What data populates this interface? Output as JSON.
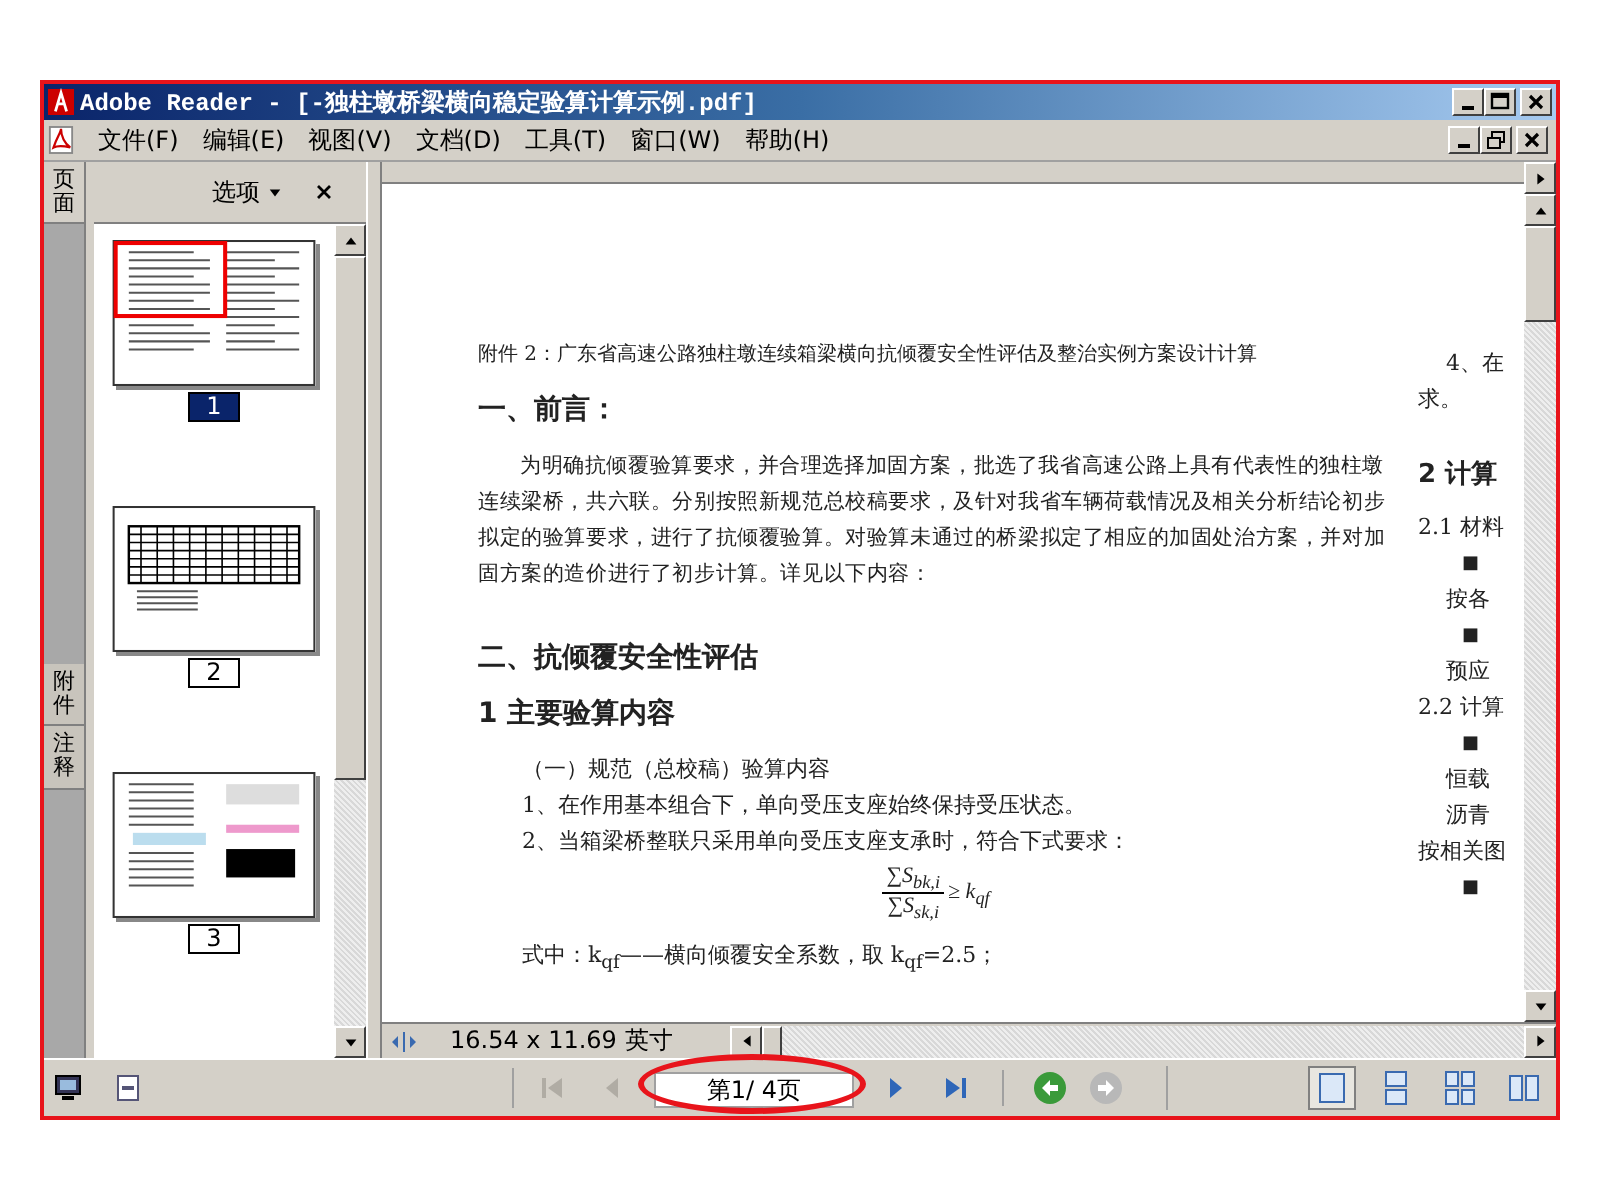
{
  "window": {
    "title": "Adobe Reader - [-独柱墩桥梁横向稳定验算计算示例.pdf]"
  },
  "menu": [
    {
      "label": "文件(F)"
    },
    {
      "label": "编辑(E)"
    },
    {
      "label": "视图(V)"
    },
    {
      "label": "文档(D)"
    },
    {
      "label": "工具(T)"
    },
    {
      "label": "窗口(W)"
    },
    {
      "label": "帮助(H)"
    }
  ],
  "side_tabs": [
    {
      "label": "页面",
      "selected": true
    },
    {
      "label": "附件",
      "selected": false
    },
    {
      "label": "注释",
      "selected": false
    }
  ],
  "panel": {
    "options": "选项"
  },
  "thumbnails": [
    {
      "label": "1",
      "selected": true,
      "kind": "text"
    },
    {
      "label": "2",
      "selected": false,
      "kind": "table"
    },
    {
      "label": "3",
      "selected": false,
      "kind": "figures"
    }
  ],
  "document": {
    "column_1": [
      {
        "kind": "caption",
        "text": "附件 2：广东省高速公路独柱墩连续箱梁横向抗倾覆安全性评估及整治实例方案设计计算"
      },
      {
        "kind": "h1",
        "text": "一、前言："
      },
      {
        "kind": "body",
        "text": "为明确抗倾覆验算要求，并合理选择加固方案，批选了我省高速公路上具有代表性的独柱墩连续梁桥，共六联。分别按照新规范总校稿要求，及针对我省车辆荷载情况及相关分析结论初步拟定的验算要求，进行了抗倾覆验算。对验算未通过的桥梁拟定了相应的加固处治方案，并对加固方案的造价进行了初步计算。详见以下内容："
      },
      {
        "kind": "h1",
        "text": "二、抗倾覆安全性评估"
      },
      {
        "kind": "h1",
        "text": "1  主要验算内容"
      },
      {
        "kind": "item",
        "text": "（一）规范（总校稿）验算内容"
      },
      {
        "kind": "item",
        "text": "1、在作用基本组合下，单向受压支座始终保持受压状态。"
      },
      {
        "kind": "item",
        "text": "2、当箱梁桥整联只采用单向受压支座支承时，符合下式要求："
      },
      {
        "kind": "formula",
        "numerator": "∑S$_{bk,i}$",
        "denominator": "∑S$_{sk,i}$",
        "rhs": "≥ k$_{qf}$"
      },
      {
        "kind": "item",
        "text": "式中：k$_{qf}$——横向倾覆安全系数，取 k$_{qf}$=2.5；"
      }
    ],
    "column_2": [
      {
        "kind": "indent",
        "text": "4、在"
      },
      {
        "kind": "plain",
        "text": "求。"
      },
      {
        "kind": "heading",
        "text": "2 计算"
      },
      {
        "kind": "plain",
        "text": "2.1 材料"
      },
      {
        "kind": "bullet",
        "text": "■"
      },
      {
        "kind": "indent",
        "text": "按各"
      },
      {
        "kind": "bullet",
        "text": "■"
      },
      {
        "kind": "indent",
        "text": "预应"
      },
      {
        "kind": "plain",
        "text": "2.2 计算"
      },
      {
        "kind": "bullet",
        "text": "■"
      },
      {
        "kind": "indent",
        "text": "恒载"
      },
      {
        "kind": "indent",
        "text": "沥青"
      },
      {
        "kind": "plain",
        "text": "按相关图"
      },
      {
        "kind": "bullet",
        "text": "■"
      }
    ]
  },
  "page_size": "16.54 x 11.69 英寸",
  "navigation": [
    {
      "kind": "first",
      "disabled": true
    },
    {
      "kind": "previous",
      "disabled": true
    },
    {
      "kind": "next",
      "disabled": false
    },
    {
      "kind": "last",
      "disabled": false
    }
  ],
  "page_field": "第1/ 4页",
  "history": [
    {
      "kind": "back",
      "disabled": false
    },
    {
      "kind": "forward",
      "disabled": true
    }
  ],
  "view_modes": [
    {
      "kind": "single",
      "selected": true
    },
    {
      "kind": "continuous",
      "selected": false
    },
    {
      "kind": "continuous-facing",
      "selected": false
    },
    {
      "kind": "facing",
      "selected": false
    }
  ]
}
